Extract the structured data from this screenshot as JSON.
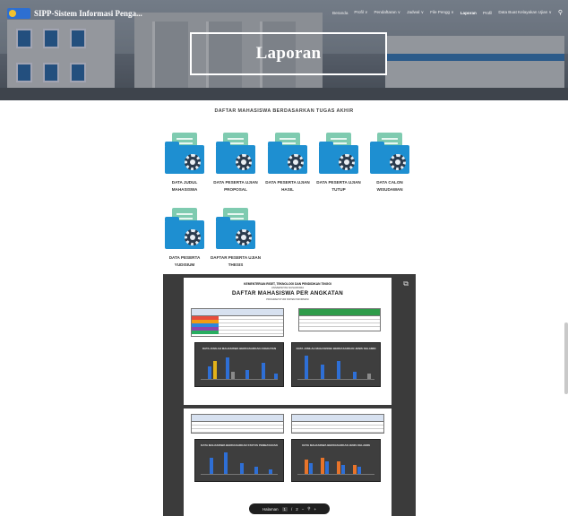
{
  "header": {
    "site_title": "SIPP-Sistem Informasi Penga...",
    "nav": [
      {
        "label": "Beranda",
        "active": false
      },
      {
        "label": "Profil ∨",
        "active": false
      },
      {
        "label": "Pendaftaran ∨",
        "active": false
      },
      {
        "label": "Jadwal ∨",
        "active": false
      },
      {
        "label": "File Pengg ∨",
        "active": false
      },
      {
        "label": "Laporan",
        "active": true
      },
      {
        "label": "Profil",
        "active": false
      },
      {
        "label": "Data Buat Kelayakan Ujian ∨",
        "active": false
      }
    ],
    "search_icon": "search-icon"
  },
  "hero": {
    "title": "Laporan"
  },
  "section": {
    "title": "DAFTAR MAHASISWA BERDASARKAN TUGAS AKHIR"
  },
  "reports": [
    {
      "line1": "DATA JUDUL",
      "line2": "MAHASISWA",
      "icon": "folder-gear-icon"
    },
    {
      "line1": "DATA PESERTA UJIAN",
      "line2": "PROPOSAL",
      "icon": "folder-gear-icon"
    },
    {
      "line1": "DATA PESERTA UJIAN",
      "line2": "HASIL",
      "icon": "folder-gear-icon"
    },
    {
      "line1": "DATA PESERTA UJIAN",
      "line2": "TUTUP",
      "icon": "folder-gear-icon"
    },
    {
      "line1": "DATA CALON",
      "line2": "WISUDAWAN",
      "icon": "folder-gear-icon"
    },
    {
      "line1": "DATA PESERTA",
      "line2": "YUDISIUM",
      "icon": "folder-gear-icon"
    },
    {
      "line1": "DAFTAR PESERTA UJIAN",
      "line2": "THESIS",
      "icon": "folder-gear-icon"
    }
  ],
  "viewer": {
    "page1_heading1": "KEMENTERIAN RISET, TEKNOLOGI DAN PENDIDIKAN TINGGI",
    "page1_heading2": "UNIVERSITAS NUSANTARA",
    "page1_title": "DAFTAR MAHASISWA PER ANGKATAN",
    "page1_subtitle": "PROGRAM STUDI SISTEM INFORMASI",
    "chart1_title": "DATA JUMLAH MAHASISWA BERDASARKAN ANGKATAN",
    "chart2_title": "DATA JUMLAH MAHASISWA BERDASARKAN JENIS KELAMIN",
    "chart3_title": "DATA MAHASISWA BERDASARKAN STATUS PEMBAYARAN",
    "chart4_title": "DATA MAHASISWA BERDASARKAN JENIS KELAMIN",
    "toolbar_label": "Halaman",
    "page_current": "1",
    "page_separator": "/",
    "page_total": "2",
    "zoom_out": "−",
    "zoom_icon": "zoom-icon",
    "zoom_in": "+"
  },
  "colors": {
    "accent_blue": "#1e8fd1",
    "doc_green": "#7fcbb0",
    "table_green": "#2e9c4a",
    "viewer_bg": "#3b3b3b"
  }
}
